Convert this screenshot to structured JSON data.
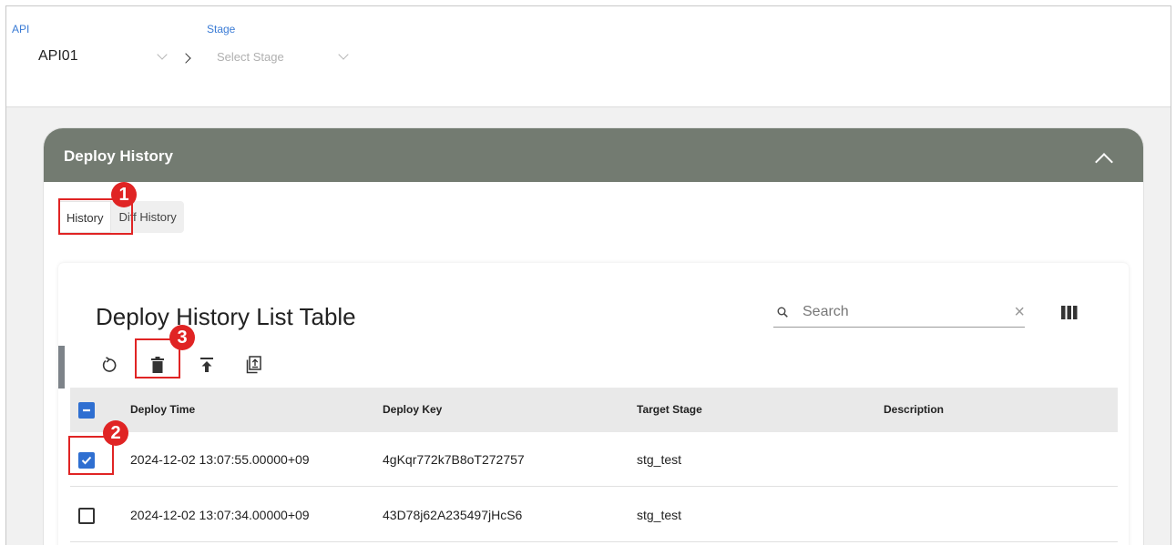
{
  "selector": {
    "api_label": "API",
    "api_value": "API01",
    "stage_label": "Stage",
    "stage_placeholder": "Select Stage"
  },
  "panel": {
    "title": "Deploy History",
    "tabs": [
      {
        "label": "History",
        "active": true
      },
      {
        "label": "Diff History",
        "active": false
      }
    ]
  },
  "table": {
    "title": "Deploy History List Table",
    "search_placeholder": "Search",
    "toolbar": [
      "refresh-icon",
      "delete-icon",
      "deploy-upload-icon",
      "export-icon"
    ],
    "columns": [
      "Deploy Time",
      "Deploy Key",
      "Target Stage",
      "Description"
    ],
    "rows": [
      {
        "deploy_time": "2024-12-02 13:07:55.00000+09",
        "deploy_key": "4gKqr772k7B8oT272757",
        "target_stage": "stg_test",
        "description": "",
        "checked": true
      },
      {
        "deploy_time": "2024-12-02 13:07:34.00000+09",
        "deploy_key": "43D78j62A235497jHcS6",
        "target_stage": "stg_test",
        "description": "",
        "checked": false
      }
    ]
  },
  "annotations": {
    "badge_1": "1",
    "badge_2": "2",
    "badge_3": "3",
    "color": "#e02424"
  },
  "colors": {
    "header_bg": "#737b71",
    "accent": "#2f6fd1",
    "link": "#3a7bd5"
  }
}
